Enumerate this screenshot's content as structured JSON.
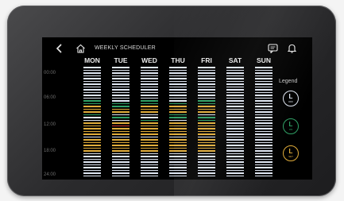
{
  "header": {
    "title": "WEEKLY SCHEDULER",
    "back_icon": "chevron-left-icon",
    "home_icon": "home-icon",
    "message_icon": "message-icon",
    "bell_icon": "bell-icon"
  },
  "days": [
    "MON",
    "TUE",
    "WED",
    "THU",
    "FRI",
    "SAT",
    "SUN"
  ],
  "times": [
    "00:00",
    "06:00",
    "12:00",
    "18:00",
    "24:00"
  ],
  "legend": {
    "title": "Legend",
    "items": [
      {
        "letter": "L",
        "sub": "OFF",
        "color": "#dfe6f2"
      },
      {
        "letter": "L",
        "sub": "ON",
        "color": "#2fa065"
      },
      {
        "letter": "L",
        "sub": "SET",
        "color": "#e0ac3a"
      }
    ]
  },
  "colors": {
    "background": "#000000",
    "off": "#dfe6f2",
    "on": "#2fa065",
    "set": "#e0ac3a",
    "current_time": "#d23a2e"
  }
}
